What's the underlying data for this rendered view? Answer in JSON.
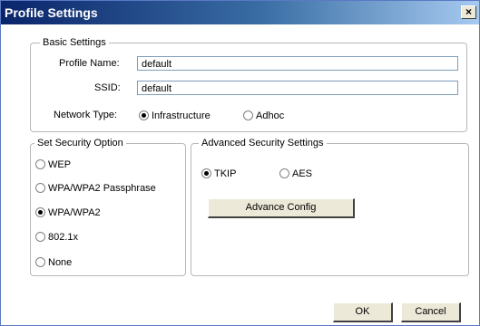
{
  "window": {
    "title": "Profile Settings",
    "close_label": "×"
  },
  "basic": {
    "legend": "Basic Settings",
    "profile_name_label": "Profile Name:",
    "profile_name_value": "default",
    "ssid_label": "SSID:",
    "ssid_value": "default",
    "network_type_label": "Network Type:",
    "options": [
      {
        "label": "Infrastructure",
        "selected": true
      },
      {
        "label": "Adhoc",
        "selected": false
      }
    ]
  },
  "security": {
    "legend": "Set Security Option",
    "options": [
      {
        "label": "WEP",
        "selected": false
      },
      {
        "label": "WPA/WPA2 Passphrase",
        "selected": false
      },
      {
        "label": "WPA/WPA2",
        "selected": true
      },
      {
        "label": "802.1x",
        "selected": false
      },
      {
        "label": "None",
        "selected": false
      }
    ]
  },
  "advanced": {
    "legend": "Advanced Security Settings",
    "options": [
      {
        "label": "TKIP",
        "selected": true
      },
      {
        "label": "AES",
        "selected": false
      }
    ],
    "config_button": "Advance Config"
  },
  "footer": {
    "ok": "OK",
    "cancel": "Cancel"
  }
}
